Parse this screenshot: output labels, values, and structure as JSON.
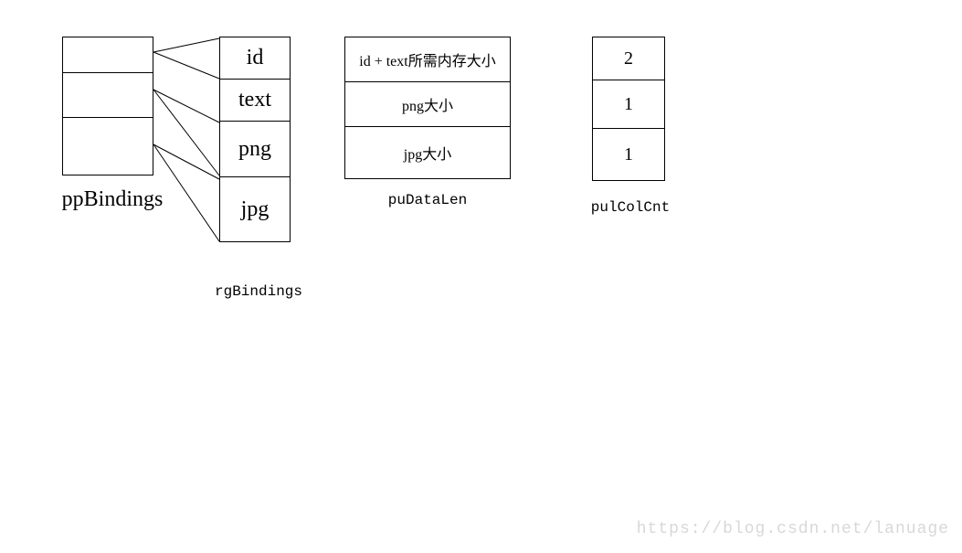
{
  "ppBindings": {
    "label": "ppBindings",
    "cells": [
      "",
      "",
      ""
    ]
  },
  "rgBindings": {
    "label": "rgBindings",
    "cells": [
      "id",
      "text",
      "png",
      "jpg"
    ]
  },
  "puDataLen": {
    "label": "puDataLen",
    "cells": [
      "id + text所需内存大小",
      "png大小",
      "jpg大小"
    ]
  },
  "pulColCnt": {
    "label": "pulColCnt",
    "cells": [
      "2",
      "1",
      "1"
    ]
  },
  "watermark": "https://blog.csdn.net/lanuage"
}
